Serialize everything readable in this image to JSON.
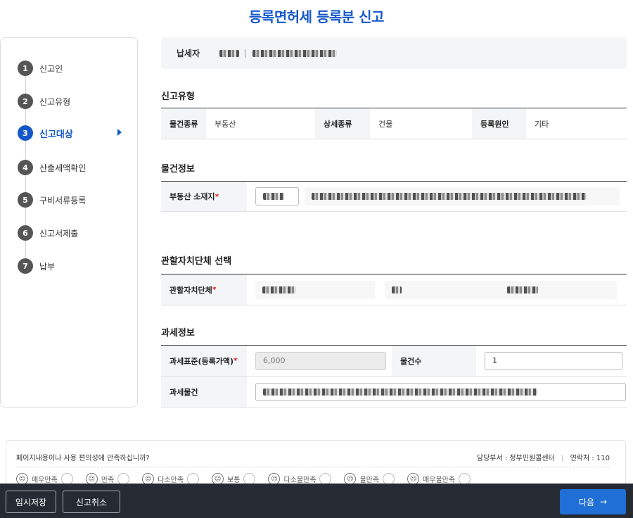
{
  "page": {
    "title": "등록면허세 등록분 신고"
  },
  "steps": [
    {
      "no": "1",
      "label": "신고인"
    },
    {
      "no": "2",
      "label": "신고유형"
    },
    {
      "no": "3",
      "label": "신고대상"
    },
    {
      "no": "4",
      "label": "산출세액확인"
    },
    {
      "no": "5",
      "label": "구비서류등록"
    },
    {
      "no": "6",
      "label": "신고서제출"
    },
    {
      "no": "7",
      "label": "납부"
    }
  ],
  "active_step": "3",
  "taxpayer": {
    "label": "납세자"
  },
  "report_type": {
    "title": "신고유형",
    "item_type_label": "물건종류",
    "item_type_value": "부동산",
    "detail_type_label": "상세종류",
    "detail_type_value": "건물",
    "reg_cause_label": "등록원인",
    "reg_cause_value": "기타"
  },
  "item_info": {
    "title": "물건정보",
    "location_label": "부동산 소재지"
  },
  "local_gov": {
    "title": "관할자치단체 선택",
    "label": "관할자치단체"
  },
  "tax_info": {
    "title": "과세정보",
    "base_label": "과세표준(등록가액)",
    "base_value": "6,000",
    "count_label": "물건수",
    "count_value": "1",
    "object_label": "과세물건"
  },
  "required_mark": "*",
  "feedback": {
    "question": "페이지내용이나 사용 편의성에 만족하십니까?",
    "dept": "담당부서 : 정부민원콜센터",
    "divider": "|",
    "contact": "연락처 : 110",
    "options": [
      "매우만족",
      "만족",
      "다소만족",
      "보통",
      "다소불만족",
      "불만족",
      "매우불만족"
    ]
  },
  "actions": {
    "temp_save": "임시저장",
    "cancel": "신고취소",
    "next": "다음",
    "next_arrow": "→"
  }
}
